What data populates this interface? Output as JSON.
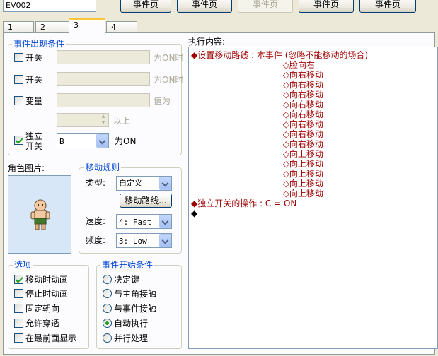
{
  "event_name": "EV002",
  "page_buttons": [
    {
      "label": "事件页",
      "enabled": true
    },
    {
      "label": "事件页",
      "enabled": true
    },
    {
      "label": "事件页",
      "enabled": false
    },
    {
      "label": "事件页",
      "enabled": true
    },
    {
      "label": "事件页",
      "enabled": true
    }
  ],
  "tabs": [
    "1",
    "2",
    "3",
    "4"
  ],
  "active_tab": "3",
  "conditions": {
    "title": "事件出现条件",
    "switch1": {
      "label": "开关",
      "suffix": "为ON时",
      "checked": false
    },
    "switch2": {
      "label": "开关",
      "suffix": "为ON时",
      "checked": false
    },
    "variable": {
      "label": "变量",
      "suffix": "值为",
      "checked": false,
      "value_suffix": "以上"
    },
    "self_switch": {
      "label": "独立\n开关",
      "label_line1": "独立",
      "label_line2": "开关",
      "value": "B",
      "suffix": "为ON",
      "checked": true
    }
  },
  "graphic": {
    "label": "角色图片:"
  },
  "movement": {
    "title": "移动规则",
    "type_label": "类型:",
    "type_value": "自定义",
    "route_button": "移动路线...",
    "speed_label": "速度:",
    "speed_value": "4: Fast",
    "freq_label": "频度:",
    "freq_value": "3: Low"
  },
  "options": {
    "title": "选项",
    "items": [
      {
        "label": "移动时动画",
        "checked": true
      },
      {
        "label": "停止时动画",
        "checked": false
      },
      {
        "label": "固定朝向",
        "checked": false
      },
      {
        "label": "允许穿透",
        "checked": false
      },
      {
        "label": "在最前面显示",
        "checked": false
      }
    ]
  },
  "trigger": {
    "title": "事件开始条件",
    "items": [
      {
        "label": "决定键",
        "checked": false
      },
      {
        "label": "与主角接触",
        "checked": false
      },
      {
        "label": "与事件接触",
        "checked": false
      },
      {
        "label": "自动执行",
        "checked": true
      },
      {
        "label": "并行处理",
        "checked": false
      }
    ]
  },
  "execution": {
    "label": "执行内容:",
    "lines": [
      {
        "text": "◆设置移动路线 : 本事件 (忽略不能移动的场合)",
        "style": "red"
      },
      {
        "text": "                                  ◇脸向右",
        "style": "red"
      },
      {
        "text": "                                  ◇向右移动",
        "style": "red"
      },
      {
        "text": "                                  ◇向右移动",
        "style": "red"
      },
      {
        "text": "                                  ◇向右移动",
        "style": "red"
      },
      {
        "text": "                                  ◇向右移动",
        "style": "red"
      },
      {
        "text": "                                  ◇向右移动",
        "style": "red"
      },
      {
        "text": "                                  ◇向右移动",
        "style": "red"
      },
      {
        "text": "                                  ◇向右移动",
        "style": "red"
      },
      {
        "text": "                                  ◇向右移动",
        "style": "red"
      },
      {
        "text": "                                  ◇向上移动",
        "style": "red"
      },
      {
        "text": "                                  ◇向上移动",
        "style": "red"
      },
      {
        "text": "                                  ◇向上移动",
        "style": "red"
      },
      {
        "text": "                                  ◇向上移动",
        "style": "red"
      },
      {
        "text": "                                  ◇向上移动",
        "style": "red"
      },
      {
        "text": "◆独立开关的操作 : C = ON",
        "style": "red"
      },
      {
        "text": "◆",
        "style": "black"
      }
    ]
  }
}
